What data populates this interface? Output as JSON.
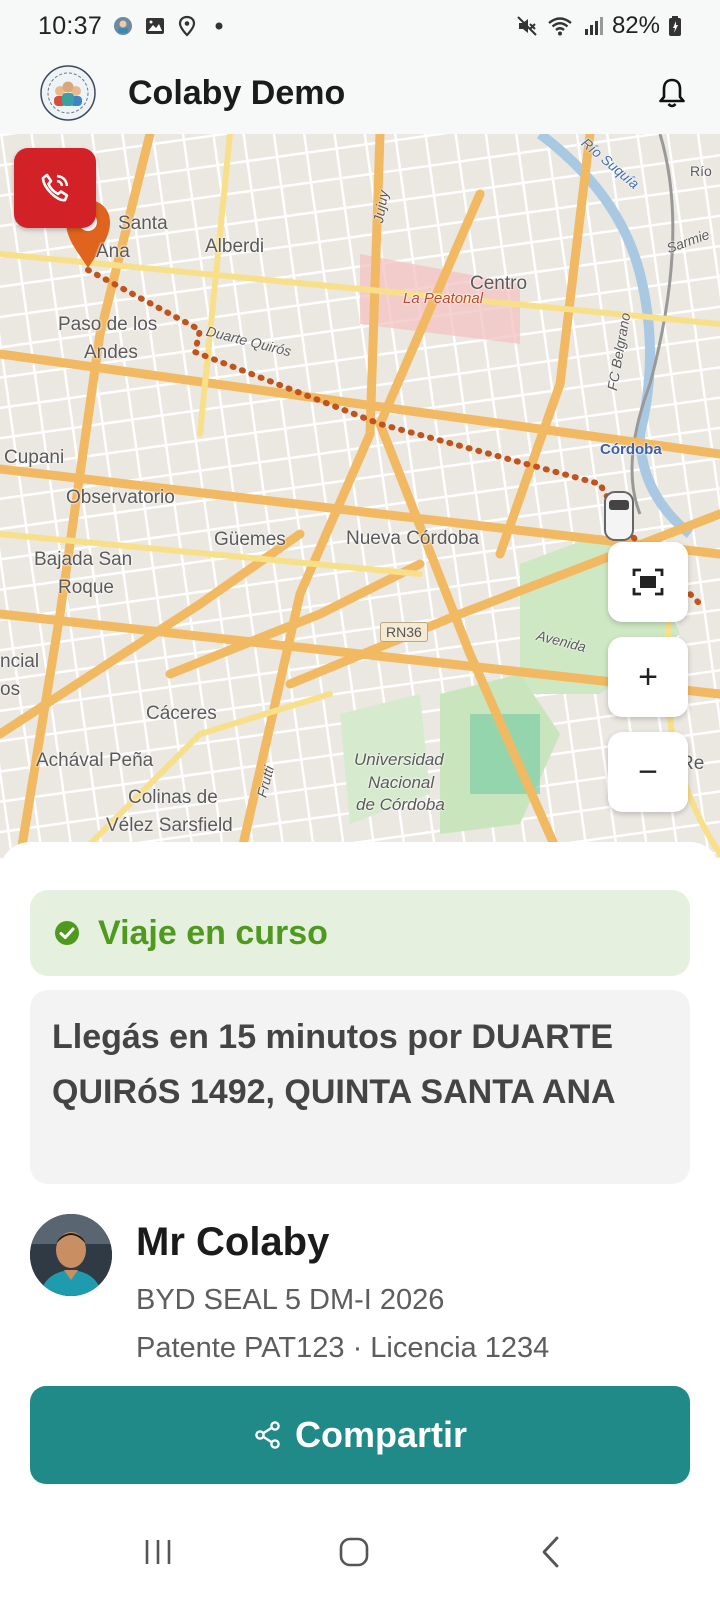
{
  "status_bar": {
    "time": "10:37",
    "battery": "82%",
    "left_icons": [
      "app-notification-icon",
      "gallery-icon",
      "location-icon",
      "dot-icon"
    ],
    "right_icons": [
      "mute-icon",
      "wifi-icon",
      "signal-icon",
      "battery-icon"
    ]
  },
  "app_bar": {
    "title": "Colaby Demo"
  },
  "map": {
    "labels": {
      "quinta_santa_ana_1": "Santa",
      "quinta_santa_ana_2": "Ana",
      "alberdi": "Alberdi",
      "jujuy": "Jujuy",
      "centro": "Centro",
      "la_peatonal": "La Peatonal",
      "paso_de_los_andes_1": "Paso de los",
      "paso_de_los_andes_2": "Andes",
      "duarte_quiros": "Duarte Quirós",
      "cordoba": "Córdoba",
      "fc_belgrano": "FC Belgrano",
      "cupani": "Cupani",
      "observatorio": "Observatorio",
      "guemes": "Güemes",
      "nueva_cordoba": "Nueva Córdoba",
      "bajada_san_roque_1": "Bajada San",
      "bajada_san_roque_2": "Roque",
      "rn36": "RN36",
      "avenida": "Avenida",
      "ncial": "ncial",
      "os": "os",
      "caceres": "Cáceres",
      "achaval_pena": "Achával Peña",
      "colinas_1": "Colinas de",
      "colinas_2": "Vélez Sarsfield",
      "frutti": "Frutti",
      "unc_1": "Universidad",
      "unc_2": "Nacional",
      "unc_3": "de Córdoba",
      "suquia": "Río Suquía",
      "sarmiento": "Sarmie",
      "rio": "Río",
      "re": "Re"
    },
    "buttons": {
      "fit": "fit-route-icon",
      "zoom_in": "+",
      "zoom_out": "−"
    }
  },
  "trip": {
    "status": "Viaje en curso",
    "status_color": "#4e9a1e",
    "eta_message": "Llegás en 15 minutos por DUARTE QUIRóS 1492, QUINTA SANTA ANA"
  },
  "driver": {
    "name": "Mr Colaby",
    "vehicle": "BYD SEAL 5 DM-I 2026",
    "plates": "Patente PAT123 · Licencia 1234"
  },
  "actions": {
    "share_label": "Compartir",
    "share_color": "#1f8a87",
    "call_color": "#d32128"
  },
  "nav_bar": {
    "items": [
      "recents-icon",
      "home-icon",
      "back-icon"
    ]
  }
}
